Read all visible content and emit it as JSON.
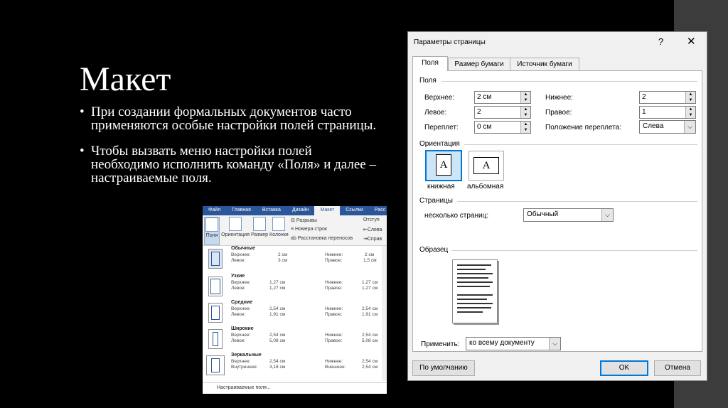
{
  "slide": {
    "title": "Макет",
    "bullets": [
      "При создании формальных документов часто применяются особые настройки полей страницы.",
      "Чтобы вызвать меню настройки полей необходимо исполнить команду «Поля» и далее – настраиваемые поля."
    ],
    "bullet_symbol": "•"
  },
  "ribbon": {
    "tabs": [
      "Файл",
      "Главная",
      "Вставка",
      "Дизайн",
      "Макет",
      "Ссылки",
      "Расс"
    ],
    "active_tab": "Макет",
    "buttons": {
      "fields": "Поля",
      "orientation": "Ориентация",
      "size": "Размер",
      "columns": "Колонки",
      "breaks": "Разрывы",
      "line_numbers": "Номера строк",
      "hyphenation": "Расстановка переносов",
      "indent": "Отступ",
      "left": "Слева",
      "right": "Справ"
    },
    "presets": [
      {
        "name": "Обычные",
        "l1": "Верхнее:",
        "v1": "2 см",
        "l2": "Левое:",
        "v2": "3 см",
        "r1": "Нижнее:",
        "rv1": "2 см",
        "r2": "Правое:",
        "rv2": "1,5 см"
      },
      {
        "name": "Узкие",
        "l1": "Верхнее:",
        "v1": "1,27 см",
        "l2": "Левое:",
        "v2": "1,27 см",
        "r1": "Нижнее:",
        "rv1": "1,27 см",
        "r2": "Правое:",
        "rv2": "1,27 см"
      },
      {
        "name": "Средние",
        "l1": "Верхнее:",
        "v1": "2,54 см",
        "l2": "Левое:",
        "v2": "1,91 см",
        "r1": "Нижнее:",
        "rv1": "2,54 см",
        "r2": "Правое:",
        "rv2": "1,91 см"
      },
      {
        "name": "Широкие",
        "l1": "Верхнее:",
        "v1": "2,54 см",
        "l2": "Левое:",
        "v2": "5,08 см",
        "r1": "Нижнее:",
        "rv1": "2,54 см",
        "r2": "Правое:",
        "rv2": "5,08 см"
      },
      {
        "name": "Зеркальные",
        "l1": "Верхнее:",
        "v1": "2,54 см",
        "l2": "Внутреннее:",
        "v2": "3,18 см",
        "r1": "Нижнее:",
        "rv1": "2,54 см",
        "r2": "Внешнее:",
        "rv2": "2,54 см"
      }
    ],
    "custom": "Настраиваемые поля..."
  },
  "dialog": {
    "title": "Параметры страницы",
    "help": "?",
    "close": "✕",
    "tabs": [
      "Поля",
      "Размер бумаги",
      "Источник бумаги"
    ],
    "margins_section": "Поля",
    "top_label": "Верхнее:",
    "top_value": "2 см",
    "bottom_label": "Нижнее:",
    "bottom_value": "2",
    "left_label": "Левое:",
    "left_value": "2",
    "right_label": "Правое:",
    "right_value": "1",
    "gutter_label": "Переплет:",
    "gutter_value": "0 см",
    "gutter_pos_label": "Положение переплета:",
    "gutter_pos_value": "Слева",
    "orientation_section": "Ориентация",
    "portrait": "книжная",
    "landscape": "альбомная",
    "orientation_glyph": "A",
    "pages_section": "Страницы",
    "multiple_pages_label": "несколько страниц:",
    "multiple_pages_value": "Обычный",
    "sample_section": "Образец",
    "apply_label": "Применить:",
    "apply_value": "ко всему документу",
    "default_button": "По умолчанию",
    "ok_button": "OK",
    "cancel_button": "Отмена"
  }
}
